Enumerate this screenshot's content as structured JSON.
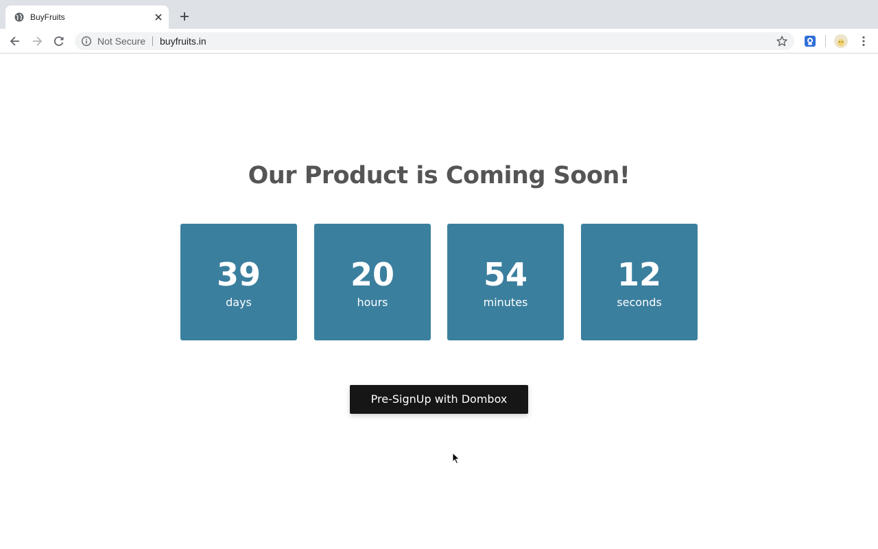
{
  "browser": {
    "tab_title": "BuyFruits",
    "security_label": "Not Secure",
    "url": "buyfruits.in"
  },
  "page": {
    "headline": "Our Product is Coming Soon!",
    "countdown": [
      {
        "value": "39",
        "unit": "days"
      },
      {
        "value": "20",
        "unit": "hours"
      },
      {
        "value": "54",
        "unit": "minutes"
      },
      {
        "value": "12",
        "unit": "seconds"
      }
    ],
    "cta_label": "Pre-SignUp with Dombox"
  },
  "colors": {
    "countdown_box": "#3b7f9e",
    "cta_background": "#161616",
    "headline": "#555555"
  },
  "icons": [
    "globe-icon",
    "close-icon",
    "plus-icon",
    "back-icon",
    "forward-icon",
    "reload-icon",
    "info-icon",
    "star-icon",
    "extension-icon",
    "avatar",
    "menu-icon"
  ]
}
